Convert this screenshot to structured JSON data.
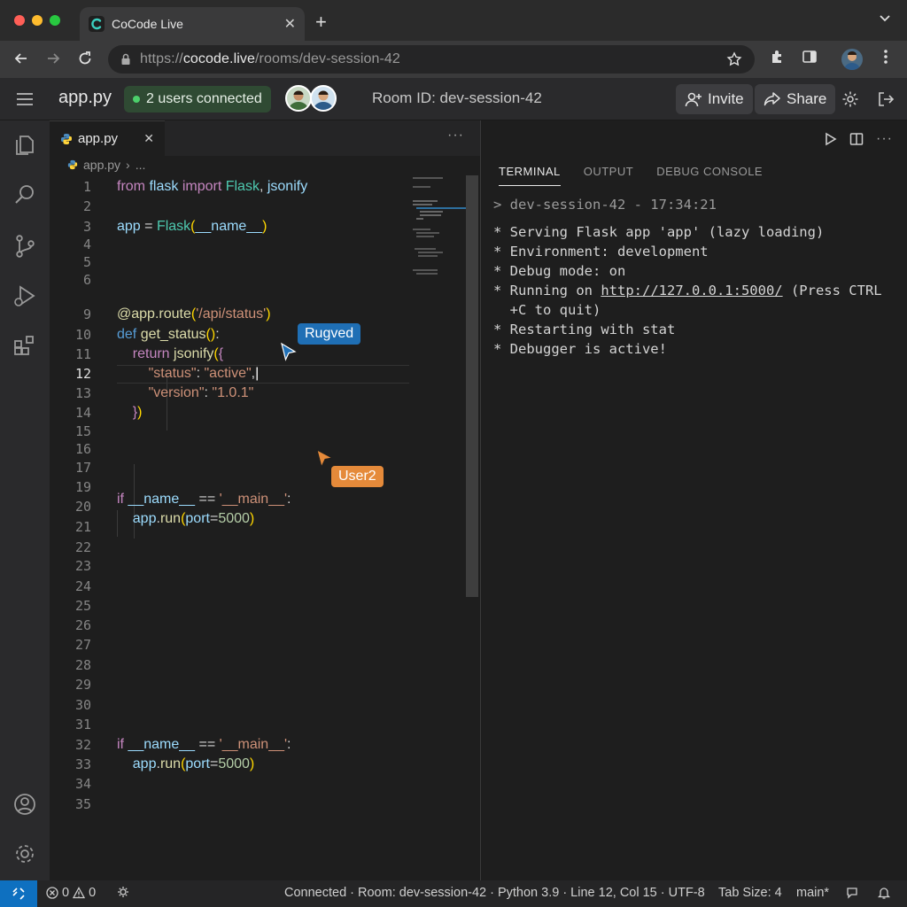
{
  "browser": {
    "tab_title": "CoCode Live",
    "url_prefix": "https://",
    "url_host": "cocode.live",
    "url_path": "/rooms/dev-session-42"
  },
  "header": {
    "file_name": "app.py",
    "users_connected": "2 users connected",
    "room_id": "Room ID: dev-session-42",
    "invite_label": "Invite",
    "share_label": "Share"
  },
  "editor": {
    "tab_label": "app.py",
    "breadcrumb_file": "app.py",
    "breadcrumb_more": "...",
    "line_numbers": [
      "1",
      "2",
      "3",
      "4",
      "5",
      "6",
      "9",
      "10",
      "11",
      "12",
      "13",
      "14",
      "15",
      "16",
      "17",
      "19",
      "20",
      "21",
      "22",
      "23",
      "24",
      "25",
      "26",
      "27",
      "28",
      "29",
      "30",
      "31",
      "32",
      "33",
      "34",
      "35"
    ],
    "cursor_labels": {
      "user1": "Rugved",
      "user2": "User2"
    }
  },
  "panel": {
    "tabs": [
      "TERMINAL",
      "OUTPUT",
      "DEBUG CONSOLE"
    ],
    "terminal_prompt": "> dev-session-42 - 17:34:21",
    "terminal_lines": [
      "* Serving Flask app 'app' (lazy loading)",
      "* Environment: development",
      "* Debug mode: on"
    ],
    "running_prefix": "* Running on ",
    "running_url": "http://127.0.0.1:5000/",
    "running_suffix": " (Press CTRL",
    "running_cont": "  +C to quit)",
    "terminal_tail": [
      "* Restarting with stat",
      "* Debugger is active!"
    ]
  },
  "status": {
    "errors": "0",
    "warnings": "0",
    "summary": "Connected · Room: dev-session-42 · Python 3.9 · Line 12, Col 15 · UTF-8",
    "tab_size": "Tab Size: 4",
    "branch": "main*"
  },
  "colors": {
    "accent_blue": "#0e70c0",
    "user1_blue": "#1f6fb5",
    "user2_orange": "#e58a3a",
    "online_green": "#4cd06b"
  }
}
